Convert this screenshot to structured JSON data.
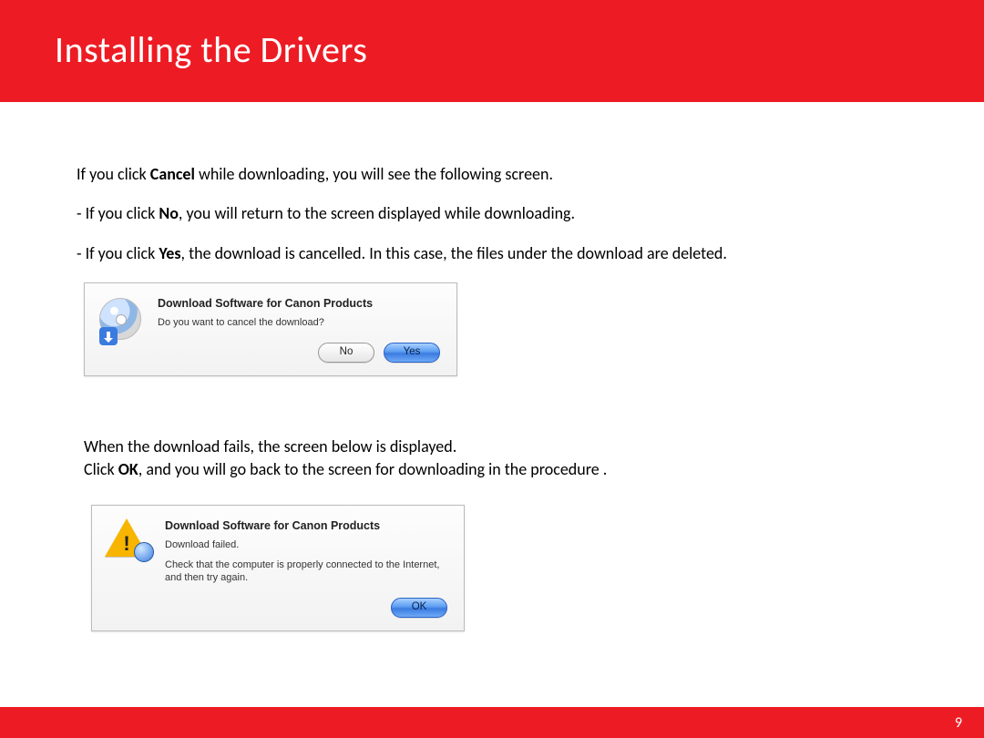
{
  "header": {
    "title": "Installing  the Drivers"
  },
  "body": {
    "intro": {
      "pre": "If you click ",
      "bold": "Cancel",
      "post": " while downloading, you will see the following screen."
    },
    "bullet1": {
      "pre": "- If you click ",
      "bold": "No",
      "post": ", you will return to the screen displayed while downloading."
    },
    "bullet2": {
      "pre": "- If you click ",
      "bold": "Yes",
      "post": ", the download is cancelled. In this case, the files under the download are deleted."
    },
    "dialog1": {
      "title": "Download Software for Canon Products",
      "message": "Do you want to cancel the download?",
      "no": "No",
      "yes": "Yes"
    },
    "section2": {
      "line1": "When the download fails, the screen below is displayed.",
      "line2_pre": "Click ",
      "line2_bold": "OK",
      "line2_post": ", and you will go back to the screen for downloading in the procedure ."
    },
    "dialog2": {
      "title": "Download Software for Canon Products",
      "msg1": "Download failed.",
      "msg2": "Check that the computer is properly connected to the Internet, and then try again.",
      "ok": "OK"
    }
  },
  "footer": {
    "page": "9"
  }
}
